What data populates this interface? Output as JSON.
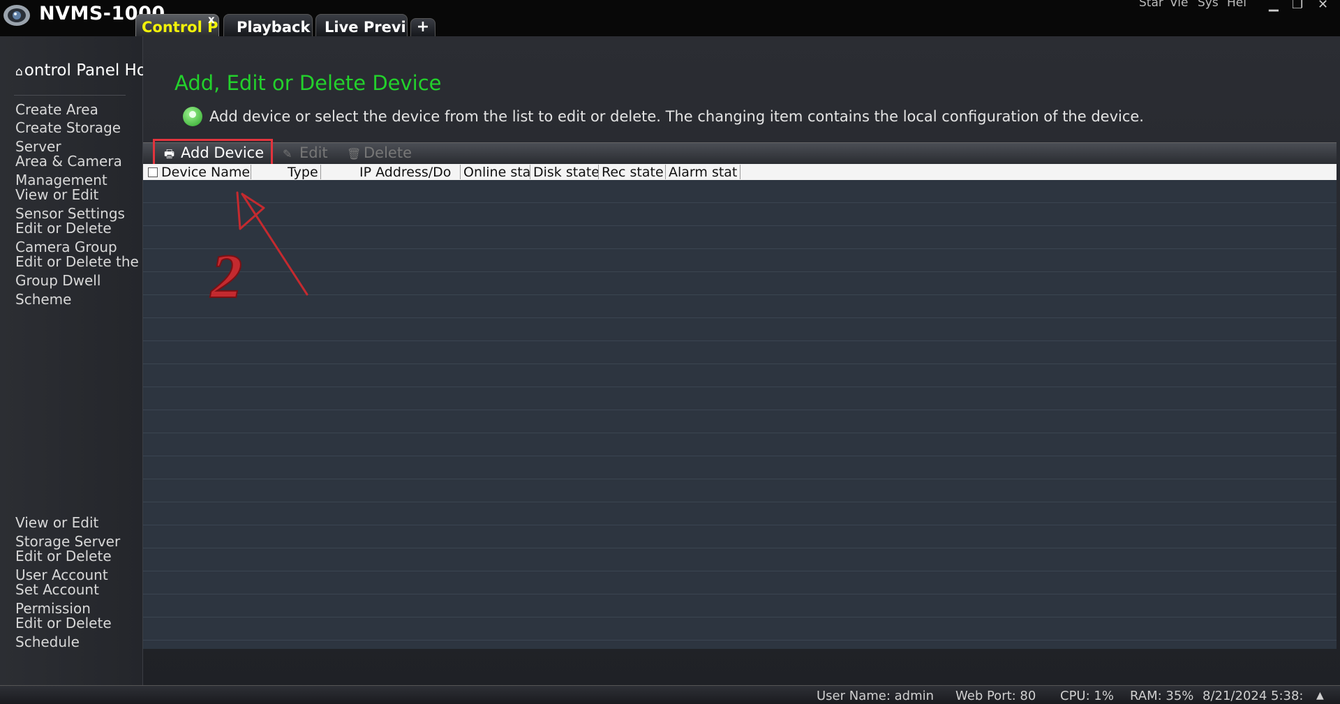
{
  "window": {
    "app_title": "NVMS-1000",
    "tabs": [
      {
        "label": "Control P"
      },
      {
        "label": "Playback"
      },
      {
        "label": "Live Previ"
      },
      {
        "label": "+"
      }
    ],
    "tab_close": "x",
    "menu": [
      "Star",
      "Vie",
      "Sys",
      "Hel"
    ],
    "controls": {
      "minimize": "▁",
      "restore": "❐",
      "close": "✕"
    }
  },
  "sidebar": {
    "home_label": "ontrol Panel Ho",
    "items_top": [
      "Create Area",
      "Create Storage Server",
      "Area & Camera Management",
      "View or Edit Sensor Settings",
      "Edit or Delete Camera Group",
      "Edit or Delete the Group Dwell Scheme"
    ],
    "items_bottom": [
      "View or Edit Storage Server",
      "Edit or Delete User Account",
      "Set Account Permission",
      "Edit or Delete Schedule"
    ]
  },
  "main": {
    "title": "Add, Edit or Delete Device",
    "info": "Add device or select the device from the list to edit or delete. The changing item contains the local configuration of the device.",
    "toolbar": {
      "add": "Add Device",
      "edit": "Edit",
      "delete": "Delete"
    },
    "columns": [
      "Device Name",
      "Type",
      "IP Address/Do",
      "Online sta",
      "Disk state",
      "Rec state",
      "Alarm stat"
    ],
    "annotation_number": "2"
  },
  "status": {
    "user": "User Name: admin",
    "port": "Web Port: 80",
    "cpu": "CPU: 1%",
    "ram": "RAM: 35%",
    "datetime": "8/21/2024 5:38:",
    "arrow": "▲"
  },
  "colors": {
    "accent_green": "#23d12c",
    "active_tab_text": "#f2f20a",
    "highlight_red": "#e2343d"
  }
}
